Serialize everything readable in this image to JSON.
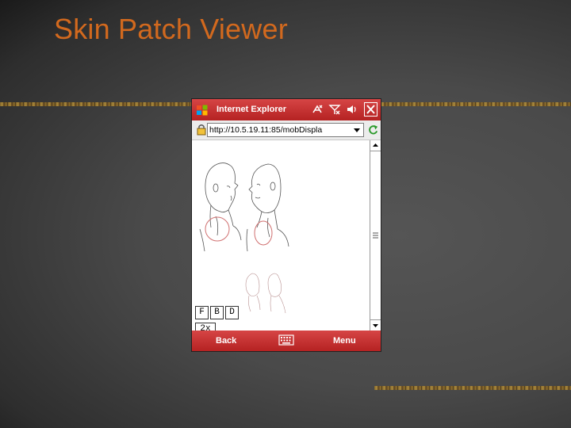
{
  "slide": {
    "title": "Skin Patch Viewer"
  },
  "browser": {
    "window_title": "Internet Explorer",
    "address": "http://10.5.19.11:85/mobDispla",
    "status_icons": [
      "connectivity-icon",
      "signal-icon",
      "volume-icon"
    ]
  },
  "viewer": {
    "buttons": [
      {
        "label": "F"
      },
      {
        "label": "B"
      },
      {
        "label": "D"
      }
    ],
    "zoom_label": "2x"
  },
  "softkeys": {
    "left": "Back",
    "right": "Menu"
  },
  "colors": {
    "title_orange": "#d2691e",
    "winmo_red": "#c43030",
    "patch_outline": "#d07070"
  }
}
